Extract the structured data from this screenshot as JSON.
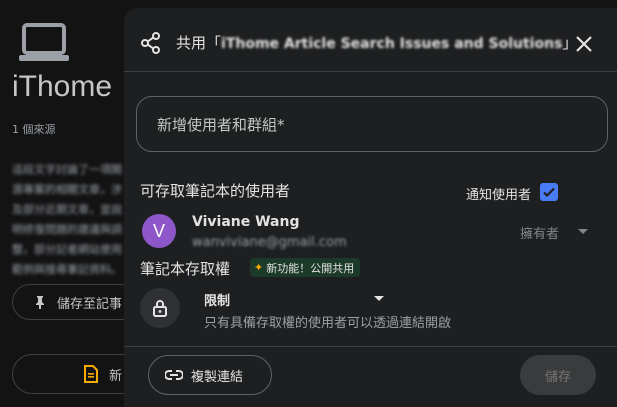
{
  "background": {
    "notebook_title": "iThome",
    "sources_count": "1 個來源",
    "description": "這段文字討論了一項開源專案的相關文章，涉及部分近期文章，並說明修復問題的建議與調整，部分記者網站使用範例與搜尋筆記資料。",
    "save_to_note_label": "儲存至記事",
    "new_note_label": "新"
  },
  "dialog": {
    "title_prefix": "共用「",
    "title_name": "iThome Article Search Issues and Solutions",
    "title_suffix": "」",
    "add_people_placeholder": "新增使用者和群組*",
    "users_heading": "可存取筆記本的使用者",
    "notify_label": "通知使用者",
    "notify_checked": true,
    "user": {
      "initial": "V",
      "name": "Viviane Wang",
      "email": "wanviviane@gmail.com",
      "role": "擁有者",
      "avatar_color": "#8e57c9"
    },
    "access_heading": "筆記本存取權",
    "new_badge": "新功能！公開共用",
    "access_level": "限制",
    "access_desc": "只有具備存取權的使用者可以透過連結開啟",
    "copy_link_label": "複製連結",
    "save_label": "儲存"
  },
  "colors": {
    "accent": "#4a7bf7",
    "surface": "#1e1f20",
    "page_bg": "#131314"
  }
}
